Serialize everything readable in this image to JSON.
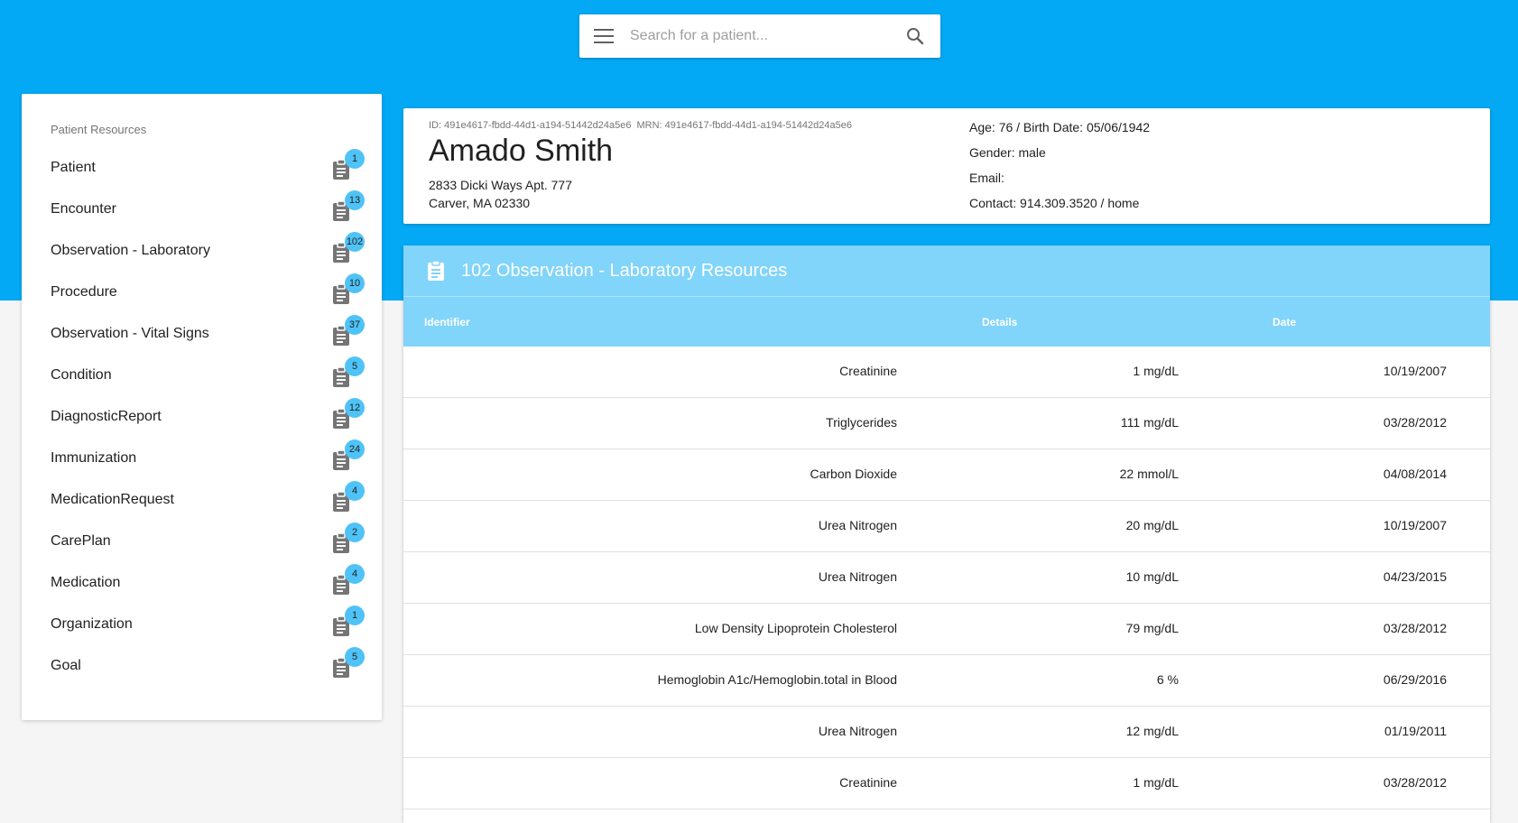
{
  "search": {
    "placeholder": "Search for a patient..."
  },
  "sidebar": {
    "title": "Patient Resources",
    "items": [
      {
        "label": "Patient",
        "count": "1"
      },
      {
        "label": "Encounter",
        "count": "13"
      },
      {
        "label": "Observation - Laboratory",
        "count": "102"
      },
      {
        "label": "Procedure",
        "count": "10"
      },
      {
        "label": "Observation - Vital Signs",
        "count": "37"
      },
      {
        "label": "Condition",
        "count": "5"
      },
      {
        "label": "DiagnosticReport",
        "count": "12"
      },
      {
        "label": "Immunization",
        "count": "24"
      },
      {
        "label": "MedicationRequest",
        "count": "4"
      },
      {
        "label": "CarePlan",
        "count": "2"
      },
      {
        "label": "Medication",
        "count": "4"
      },
      {
        "label": "Organization",
        "count": "1"
      },
      {
        "label": "Goal",
        "count": "5"
      }
    ]
  },
  "patient": {
    "id": "ID: 491e4617-fbdd-44d1-a194-51442d24a5e6",
    "mrn": "MRN: 491e4617-fbdd-44d1-a194-51442d24a5e6",
    "name": "Amado Smith",
    "address_line1": "2833 Dicki Ways Apt. 777",
    "address_line2": "Carver, MA 02330",
    "age_birth": "Age: 76 / Birth Date: 05/06/1942",
    "gender": "Gender: male",
    "email": "Email:",
    "contact": "Contact: 914.309.3520 / home"
  },
  "resources": {
    "title": "102 Observation - Laboratory Resources",
    "columns": {
      "identifier": "Identifier",
      "details": "Details",
      "date": "Date"
    },
    "rows": [
      {
        "identifier": "Creatinine",
        "details": "1 mg/dL",
        "date": "10/19/2007"
      },
      {
        "identifier": "Triglycerides",
        "details": "111 mg/dL",
        "date": "03/28/2012"
      },
      {
        "identifier": "Carbon Dioxide",
        "details": "22 mmol/L",
        "date": "04/08/2014"
      },
      {
        "identifier": "Urea Nitrogen",
        "details": "20 mg/dL",
        "date": "10/19/2007"
      },
      {
        "identifier": "Urea Nitrogen",
        "details": "10 mg/dL",
        "date": "04/23/2015"
      },
      {
        "identifier": "Low Density Lipoprotein Cholesterol",
        "details": "79 mg/dL",
        "date": "03/28/2012"
      },
      {
        "identifier": "Hemoglobin A1c/Hemoglobin.total in Blood",
        "details": "6 %",
        "date": "06/29/2016"
      },
      {
        "identifier": "Urea Nitrogen",
        "details": "12 mg/dL",
        "date": "01/19/2011"
      },
      {
        "identifier": "Creatinine",
        "details": "1 mg/dL",
        "date": "03/28/2012"
      }
    ]
  },
  "colors": {
    "primary": "#03a9f4",
    "header_light": "#81d4fa",
    "badge": "#4fc3f7",
    "icon": "#616161"
  },
  "icons": {
    "menu": "menu-icon",
    "search": "search-icon",
    "document": "document-icon",
    "clipboard": "clipboard-icon"
  }
}
